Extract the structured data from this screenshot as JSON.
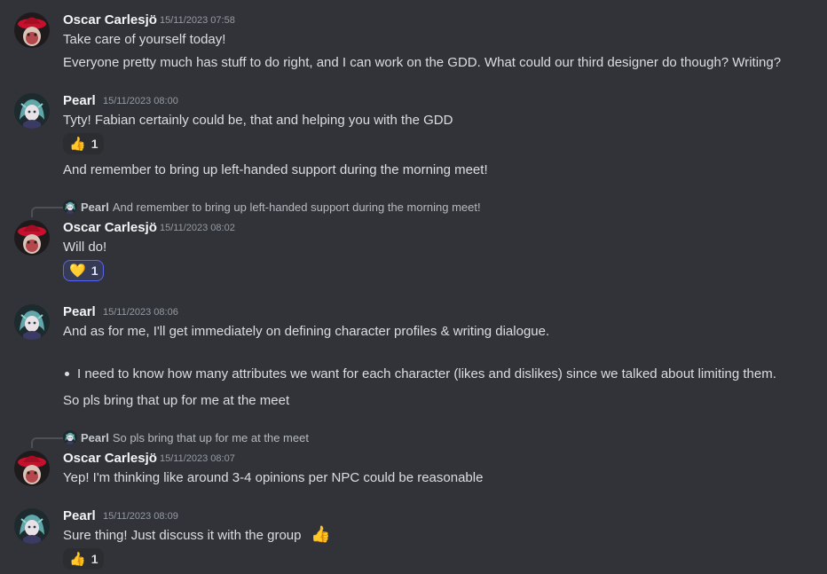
{
  "colors": {
    "background": "#313338",
    "text": "#dbdee1",
    "username": "#f2f3f5",
    "timestamp": "#949ba4",
    "reaction_active_border": "#5865f2"
  },
  "messages": {
    "m1": {
      "author": "Oscar Carlesjö",
      "time": "15/11/2023 07:58",
      "line1": "Take care of yourself today!",
      "line2": "Everyone pretty much has stuff to do right, and I can work on the GDD. What could our third designer do though? Writing?"
    },
    "m2": {
      "author": "Pearl",
      "time": "15/11/2023 08:00",
      "line1": "Tyty! Fabian certainly could be, that and helping you with the GDD",
      "reaction": {
        "emoji": "👍",
        "icon": "thumbs-up-icon",
        "count": "1"
      },
      "line2": "And remember to bring up  left-handed support during the morning meet!"
    },
    "m3": {
      "reply": {
        "author": "Pearl",
        "text": "And remember to bring up left-handed support during the morning meet!"
      },
      "author": "Oscar Carlesjö",
      "time": "15/11/2023 08:02",
      "line1": "Will do!",
      "reaction": {
        "emoji": "💛",
        "icon": "yellow-heart-icon",
        "count": "1"
      }
    },
    "m4": {
      "author": "Pearl",
      "time": "15/11/2023 08:06",
      "line1": "And as for me, I'll get immediately on defining character profiles & writing dialogue.",
      "bullet": "I need to know how many attributes we want for each character (likes and dislikes) since we talked about limiting them.",
      "line2": "So pls bring that up for me at the meet"
    },
    "m5": {
      "reply": {
        "author": "Pearl",
        "text": "So pls bring that up for me at the meet"
      },
      "author": "Oscar Carlesjö",
      "time": "15/11/2023 08:07",
      "line1": "Yep! I'm thinking like around 3-4 opinions per NPC could be reasonable"
    },
    "m6": {
      "author": "Pearl",
      "time": "15/11/2023 08:09",
      "line1": "Sure thing! Just discuss it with the group",
      "inline_emoji": {
        "emoji": "👍",
        "icon": "thumbs-up-icon"
      },
      "reaction": {
        "emoji": "👍",
        "icon": "thumbs-up-icon",
        "count": "1"
      }
    }
  }
}
